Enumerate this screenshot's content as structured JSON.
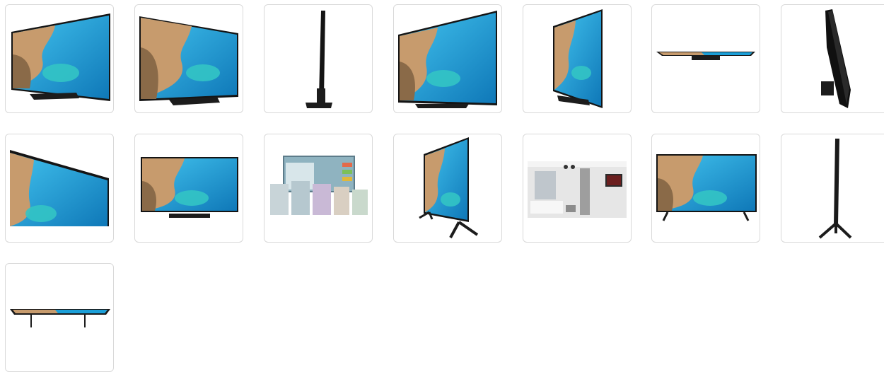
{
  "gallery": {
    "colors": {
      "sea": "#1b9fd8",
      "sea_light": "#3bbce8",
      "lagoon": "#33c4c4",
      "cliff": "#c79b6d",
      "cliff_dark": "#8a6a48",
      "bezel": "#141414",
      "stand": "#1c1c1c",
      "thumb_border": "#d9d9d9"
    },
    "thumbnails": [
      {
        "view": "front-left-angle"
      },
      {
        "view": "front-left-angle-large"
      },
      {
        "view": "side-profile"
      },
      {
        "view": "front-right-angle"
      },
      {
        "view": "front-angle-narrow"
      },
      {
        "view": "top-view"
      },
      {
        "view": "rear-angle"
      },
      {
        "view": "screen-closeup"
      },
      {
        "view": "front"
      },
      {
        "view": "menu-ui"
      },
      {
        "view": "front-angle-feet"
      },
      {
        "view": "hotel-room"
      },
      {
        "view": "front-feet"
      },
      {
        "view": "side-profile-feet"
      },
      {
        "view": "top-view-feet"
      }
    ]
  }
}
